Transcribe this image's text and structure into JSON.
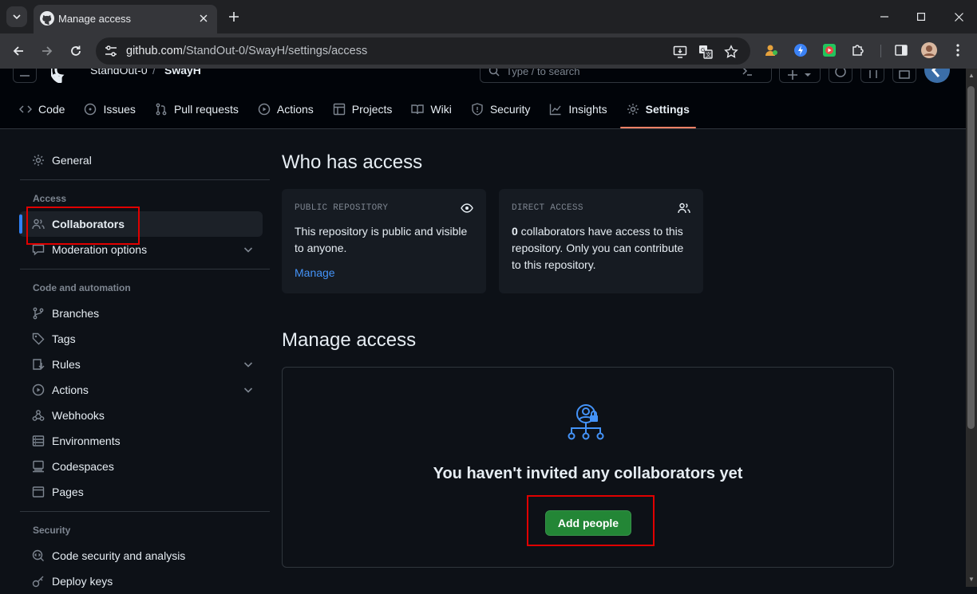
{
  "browser": {
    "tab_title": "Manage access",
    "url_host": "github.com",
    "url_path": "/StandOut-0/SwayH/settings/access"
  },
  "header": {
    "owner": "StandOut-0",
    "separator": "/",
    "repo": "SwayH",
    "search_placeholder": "Type / to search"
  },
  "repo_nav": [
    {
      "label": "Code",
      "icon": "code-icon"
    },
    {
      "label": "Issues",
      "icon": "issue-icon"
    },
    {
      "label": "Pull requests",
      "icon": "pull-request-icon"
    },
    {
      "label": "Actions",
      "icon": "play-icon"
    },
    {
      "label": "Projects",
      "icon": "table-icon"
    },
    {
      "label": "Wiki",
      "icon": "book-icon"
    },
    {
      "label": "Security",
      "icon": "shield-icon"
    },
    {
      "label": "Insights",
      "icon": "graph-icon"
    },
    {
      "label": "Settings",
      "icon": "gear-icon",
      "active": true
    }
  ],
  "sidebar": {
    "general": "General",
    "access_heading": "Access",
    "collaborators": "Collaborators",
    "moderation": "Moderation options",
    "code_heading": "Code and automation",
    "branches": "Branches",
    "tags": "Tags",
    "rules": "Rules",
    "actions": "Actions",
    "webhooks": "Webhooks",
    "environments": "Environments",
    "codespaces": "Codespaces",
    "pages": "Pages",
    "security_heading": "Security",
    "code_security": "Code security and analysis",
    "deploy_keys": "Deploy keys"
  },
  "main": {
    "who_title": "Who has access",
    "public_card": {
      "caption": "PUBLIC REPOSITORY",
      "text": "This repository is public and visible to anyone.",
      "link": "Manage"
    },
    "direct_card": {
      "caption": "DIRECT ACCESS",
      "count": "0",
      "text": " collaborators have access to this repository. Only you can contribute to this repository."
    },
    "manage_title": "Manage access",
    "empty_title": "You haven't invited any collaborators yet",
    "add_button": "Add people"
  },
  "colors": {
    "page_bg": "#0d1117",
    "header_bg": "#010409",
    "card_bg": "#161b22",
    "accent_link": "#4493f8",
    "primary_button": "#238636",
    "active_underline": "#f78166",
    "highlight": "#e00000"
  }
}
